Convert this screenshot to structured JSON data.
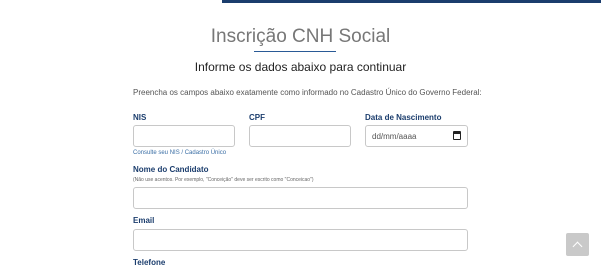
{
  "header": {
    "title": "Inscrição CNH Social",
    "subtitle": "Informe os dados abaixo para continuar"
  },
  "form": {
    "instructions": "Preencha os campos abaixo exatamente como informado no Cadastro Único do Governo Federal:",
    "nis": {
      "label": "NIS",
      "value": "",
      "help_link": "Consulte seu NIS / Cadastro Único"
    },
    "cpf": {
      "label": "CPF",
      "value": ""
    },
    "birth": {
      "label": "Data de Nascimento",
      "placeholder": "dd/mm/aaaa"
    },
    "name": {
      "label": "Nome do Candidato",
      "hint": "(Não use acentos. Por exemplo, \"Conceição\" deve ser escrito como \"Conceicao\")",
      "value": ""
    },
    "email": {
      "label": "Email",
      "value": ""
    },
    "phone": {
      "label": "Telefone"
    }
  },
  "colors": {
    "primary": "#1b3d6d",
    "link": "#3a6ea5",
    "scroll_button": "#c9c9c9"
  },
  "icons": {
    "calendar": "calendar-icon",
    "scroll_top": "chevron-up-icon"
  }
}
